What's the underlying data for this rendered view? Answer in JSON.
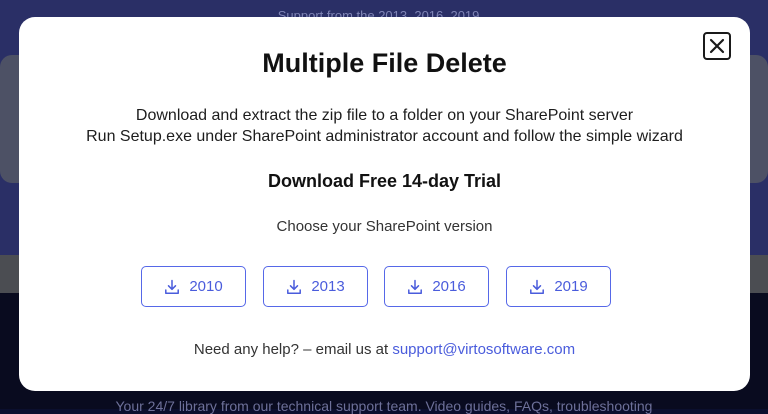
{
  "background": {
    "top_text": "Support from the 2013, 2016, 2019...",
    "bottom_text": "Your 24/7 library from our technical support team. Video guides, FAQs, troubleshooting"
  },
  "modal": {
    "title": "Multiple File Delete",
    "instructions": [
      "Download and extract the zip file to a folder on your SharePoint server",
      "Run Setup.exe under SharePoint administrator account and follow the simple wizard"
    ],
    "trial_heading": "Download Free 14-day Trial",
    "choose_label": "Choose your SharePoint version",
    "versions": [
      {
        "label": "2010",
        "icon": "download-icon"
      },
      {
        "label": "2013",
        "icon": "download-icon"
      },
      {
        "label": "2016",
        "icon": "download-icon"
      },
      {
        "label": "2019",
        "icon": "download-icon"
      }
    ],
    "help_prefix": "Need any help? – email us at",
    "help_email": "support@virtosoftware.com",
    "close_icon": "close-icon"
  },
  "colors": {
    "accent": "#4a5cdc",
    "button_border": "#5668e8",
    "overlay_top": "#2a2f66",
    "overlay_bottom": "#090b1f"
  }
}
